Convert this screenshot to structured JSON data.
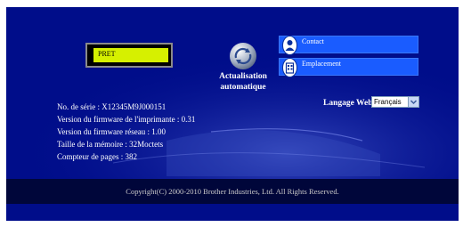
{
  "lcd": {
    "status": "PRET",
    "background_color": "#d6f000"
  },
  "update": {
    "label_line1": "Actualisation",
    "label_line2": "automatique",
    "icon": "refresh-icon"
  },
  "nav": {
    "contact": {
      "label": "Contact",
      "icon": "contact-icon"
    },
    "location": {
      "label": "Emplacement",
      "icon": "location-icon"
    }
  },
  "info": {
    "serial": "No. de série : X12345M9J000151",
    "firmware_printer": "Version du firmware de l'imprimante : 0.31",
    "firmware_network": "Version du firmware réseau : 1.00",
    "memory": "Taille de la mémoire : 32Moctets",
    "page_counter": "Compteur de pages : 382"
  },
  "language": {
    "label": "Langage Web:",
    "selected": "Français"
  },
  "footer": {
    "copyright": "Copyright(C) 2000-2010 Brother Industries, Ltd. All Rights Reserved."
  },
  "colors": {
    "panel": "#000d8a",
    "nav_button": "#1a5cff",
    "footer": "#00063a"
  }
}
